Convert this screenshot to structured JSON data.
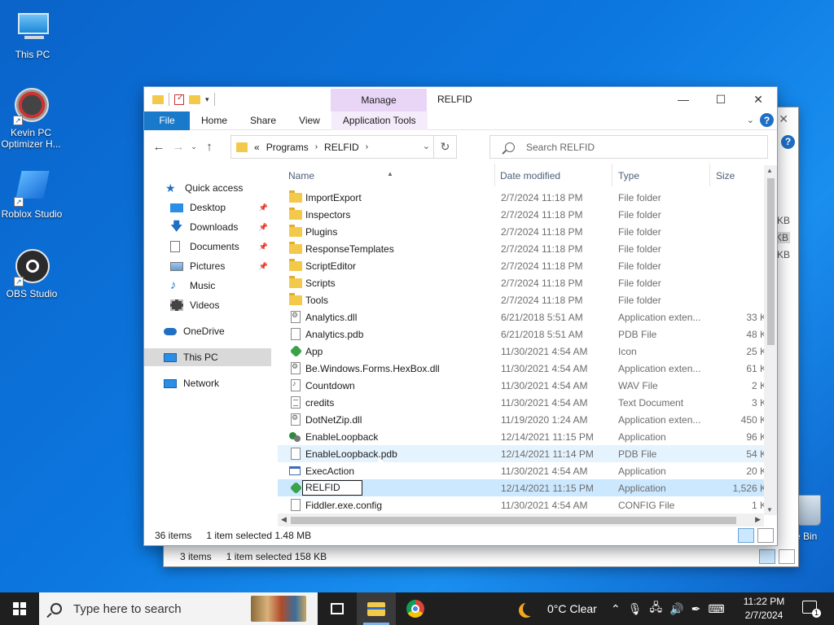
{
  "desktop": {
    "icons": [
      {
        "label": "This PC"
      },
      {
        "label": "Kevin PC Optimizer H..."
      },
      {
        "label": "Roblox Studio"
      },
      {
        "label": "OBS Studio"
      }
    ],
    "recycle_bin_label": "e Bin"
  },
  "back_window": {
    "status_items": "3 items",
    "status_selected": "1 item selected  158 KB",
    "side_sizes": [
      "KB",
      "KB",
      "KB"
    ]
  },
  "window": {
    "title": "RELFID",
    "manage_tab": "Manage",
    "ribbon_tabs": {
      "file": "File",
      "home": "Home",
      "share": "Share",
      "view": "View",
      "app_tools": "Application Tools"
    },
    "help_label": "?",
    "address": {
      "prefix": "«",
      "crumbs": [
        "Programs",
        "RELFID"
      ]
    },
    "search_placeholder": "Search RELFID",
    "nav": {
      "quick_access": "Quick access",
      "desktop": "Desktop",
      "downloads": "Downloads",
      "documents": "Documents",
      "pictures": "Pictures",
      "music": "Music",
      "videos": "Videos",
      "onedrive": "OneDrive",
      "this_pc": "This PC",
      "network": "Network"
    },
    "columns": {
      "name": "Name",
      "date": "Date modified",
      "type": "Type",
      "size": "Size"
    },
    "files": [
      {
        "name": "ImportExport",
        "date": "2/7/2024 11:18 PM",
        "type": "File folder",
        "size": "",
        "icon": "folder"
      },
      {
        "name": "Inspectors",
        "date": "2/7/2024 11:18 PM",
        "type": "File folder",
        "size": "",
        "icon": "folder"
      },
      {
        "name": "Plugins",
        "date": "2/7/2024 11:18 PM",
        "type": "File folder",
        "size": "",
        "icon": "folder"
      },
      {
        "name": "ResponseTemplates",
        "date": "2/7/2024 11:18 PM",
        "type": "File folder",
        "size": "",
        "icon": "folder"
      },
      {
        "name": "ScriptEditor",
        "date": "2/7/2024 11:18 PM",
        "type": "File folder",
        "size": "",
        "icon": "folder"
      },
      {
        "name": "Scripts",
        "date": "2/7/2024 11:18 PM",
        "type": "File folder",
        "size": "",
        "icon": "folder"
      },
      {
        "name": "Tools",
        "date": "2/7/2024 11:18 PM",
        "type": "File folder",
        "size": "",
        "icon": "folder"
      },
      {
        "name": "Analytics.dll",
        "date": "6/21/2018 5:51 AM",
        "type": "Application exten...",
        "size": "33 K",
        "icon": "dll"
      },
      {
        "name": "Analytics.pdb",
        "date": "6/21/2018 5:51 AM",
        "type": "PDB File",
        "size": "48 K",
        "icon": "doc"
      },
      {
        "name": "App",
        "date": "11/30/2021 4:54 AM",
        "type": "Icon",
        "size": "25 K",
        "icon": "fid"
      },
      {
        "name": "Be.Windows.Forms.HexBox.dll",
        "date": "11/30/2021 4:54 AM",
        "type": "Application exten...",
        "size": "61 K",
        "icon": "dll"
      },
      {
        "name": "Countdown",
        "date": "11/30/2021 4:54 AM",
        "type": "WAV File",
        "size": "2 K",
        "icon": "wav"
      },
      {
        "name": "credits",
        "date": "11/30/2021 4:54 AM",
        "type": "Text Document",
        "size": "3 K",
        "icon": "text"
      },
      {
        "name": "DotNetZip.dll",
        "date": "11/19/2020 1:24 AM",
        "type": "Application exten...",
        "size": "450 K",
        "icon": "dll"
      },
      {
        "name": "EnableLoopback",
        "date": "12/14/2021 11:15 PM",
        "type": "Application",
        "size": "96 K",
        "icon": "loop"
      },
      {
        "name": "EnableLoopback.pdb",
        "date": "12/14/2021 11:14 PM",
        "type": "PDB File",
        "size": "54 K",
        "icon": "doc"
      },
      {
        "name": "ExecAction",
        "date": "11/30/2021 4:54 AM",
        "type": "Application",
        "size": "20 K",
        "icon": "app"
      },
      {
        "name": "RELFID",
        "date": "12/14/2021 11:15 PM",
        "type": "Application",
        "size": "1,526 K",
        "icon": "fid"
      },
      {
        "name": "Fiddler.exe.config",
        "date": "11/30/2021 4:54 AM",
        "type": "CONFIG File",
        "size": "1 K",
        "icon": "doc"
      }
    ],
    "status_items": "36 items",
    "status_selected": "1 item selected  1.48 MB"
  },
  "taskbar": {
    "search_placeholder": "Type here to search",
    "weather": "0°C  Clear",
    "time": "11:22 PM",
    "date": "2/7/2024",
    "notification_count": "1"
  }
}
